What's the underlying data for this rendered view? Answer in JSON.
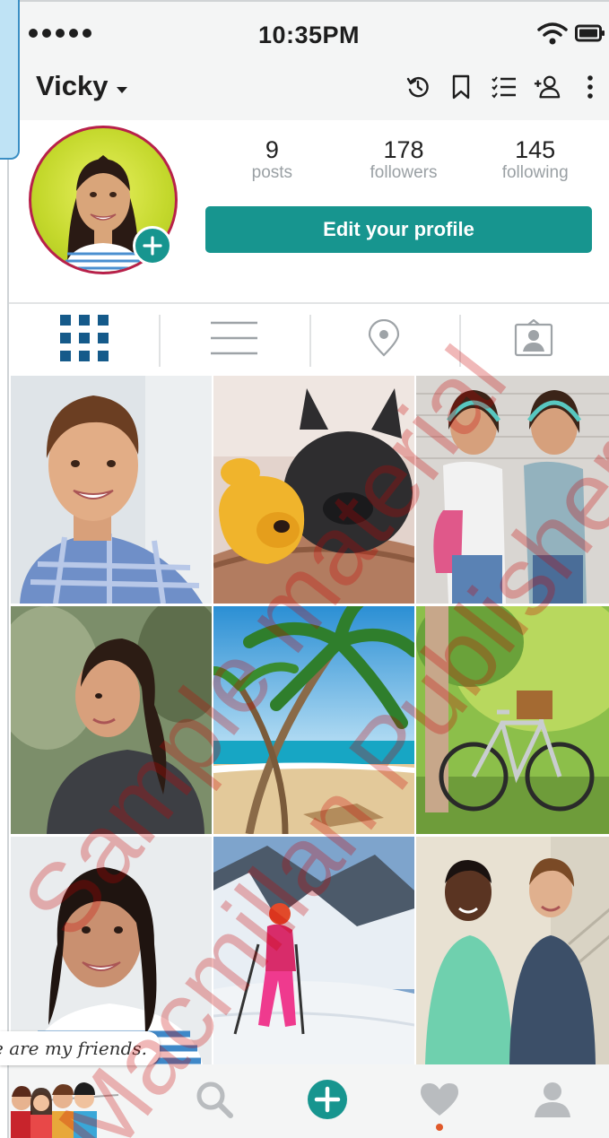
{
  "status_bar": {
    "time": "10:35PM",
    "signal_icon": "signal-dots-icon",
    "wifi_icon": "wifi-icon",
    "battery_icon": "battery-icon"
  },
  "header": {
    "username": "Vicky",
    "icons": [
      "history-icon",
      "bookmark-icon",
      "list-icon",
      "add-user-icon",
      "more-icon"
    ]
  },
  "profile": {
    "avatar_icon": "avatar-photo",
    "stats": [
      {
        "value": "9",
        "label": "posts"
      },
      {
        "value": "178",
        "label": "followers"
      },
      {
        "value": "145",
        "label": "following"
      }
    ],
    "edit_button": "Edit your profile"
  },
  "tabs": [
    "grid-icon",
    "list-view-icon",
    "location-icon",
    "tagged-icon"
  ],
  "photos": [
    "smiling young man in plaid shirt",
    "french bulldog with plush toy",
    "two girls with headphones",
    "girl with ponytail looking back",
    "palm trees on beach",
    "bicycle with basket in park",
    "girl smiling looking up",
    "skier on snowy mountain",
    "two boys with backpacks"
  ],
  "caption": "se are my friends.",
  "nav": [
    "friends-illustration",
    "search-icon",
    "add-post-icon",
    "heart-icon",
    "profile-icon"
  ],
  "watermark": {
    "line1": "Sample material",
    "line2": "Macmillan Publishers"
  },
  "colors": {
    "accent": "#17958f",
    "avatar_ring": "#b8204a",
    "notification_dot": "#e0592a"
  }
}
